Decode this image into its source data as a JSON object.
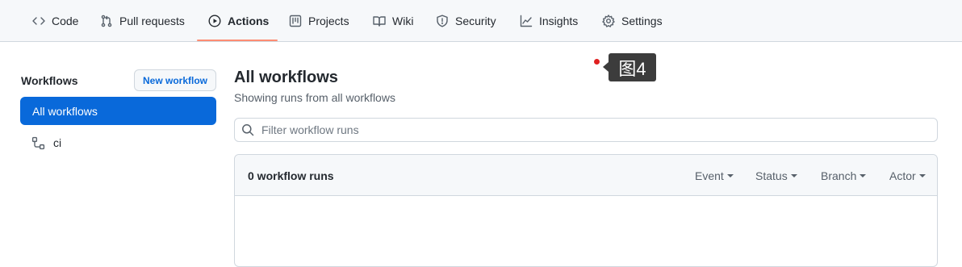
{
  "tabs": [
    {
      "label": "Code",
      "icon": "code-icon"
    },
    {
      "label": "Pull requests",
      "icon": "git-pull-request-icon"
    },
    {
      "label": "Actions",
      "icon": "play-icon",
      "active": true
    },
    {
      "label": "Projects",
      "icon": "project-board-icon"
    },
    {
      "label": "Wiki",
      "icon": "book-icon"
    },
    {
      "label": "Security",
      "icon": "shield-icon"
    },
    {
      "label": "Insights",
      "icon": "graph-icon"
    },
    {
      "label": "Settings",
      "icon": "gear-icon"
    }
  ],
  "callout": {
    "label": "图4",
    "dot_color": "#e02020"
  },
  "sidebar": {
    "title": "Workflows",
    "new_button": "New workflow",
    "items": [
      {
        "label": "All workflows",
        "active": true
      },
      {
        "label": "ci",
        "icon": "workflow-icon"
      }
    ]
  },
  "main": {
    "title": "All workflows",
    "subtitle": "Showing runs from all workflows",
    "filter_placeholder": "Filter workflow runs",
    "runs_count": "0 workflow runs",
    "filters": [
      "Event",
      "Status",
      "Branch",
      "Actor"
    ]
  },
  "colors": {
    "accent": "#0969da",
    "active_underline": "#fd8c73"
  }
}
